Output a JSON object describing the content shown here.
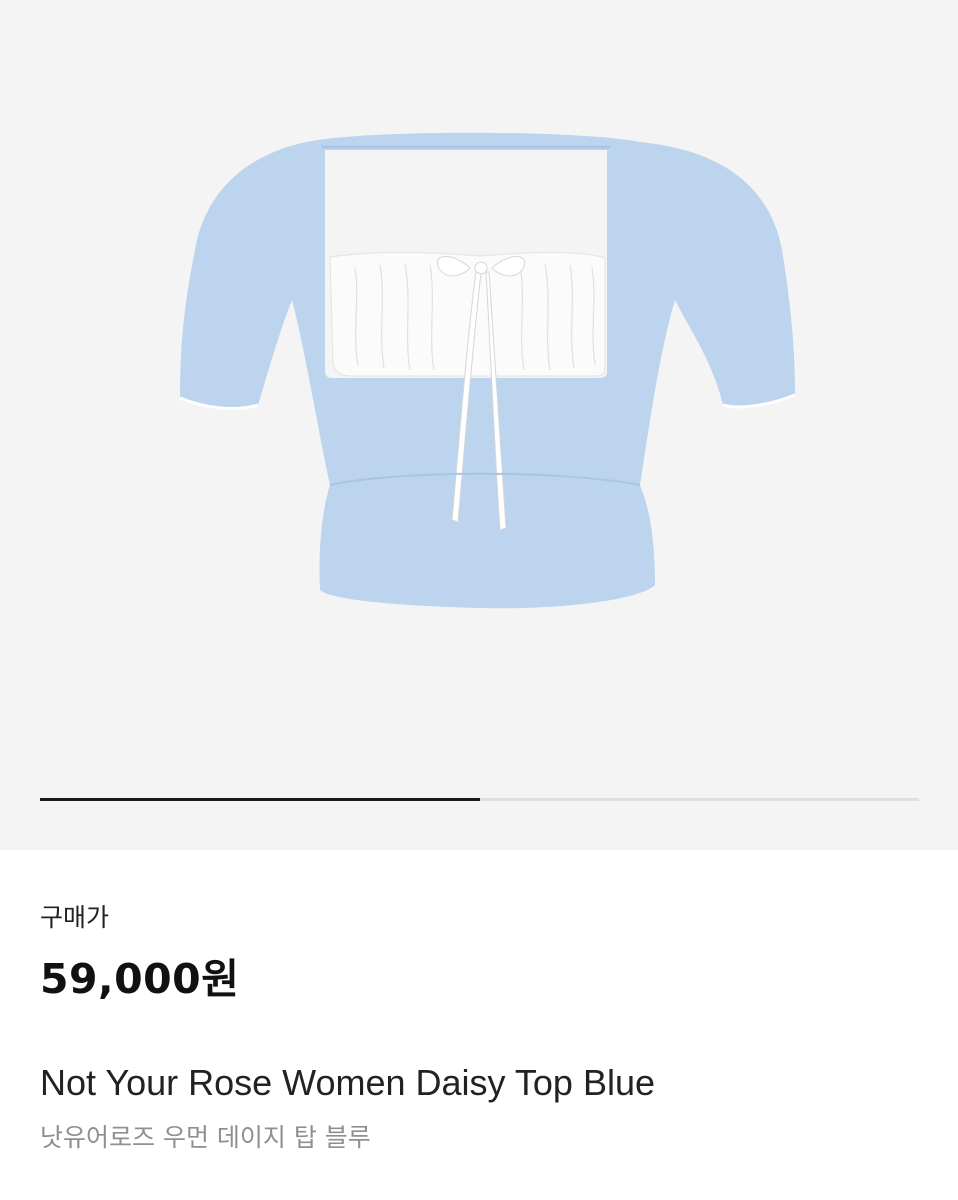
{
  "gallery": {
    "image_alt": "Not Your Rose Women Daisy Top Blue",
    "progress": 0.5,
    "progress_color": "#1a1a1a",
    "track_color": "#dedede",
    "background_color": "#f4f4f4"
  },
  "product": {
    "price_label": "구매가",
    "price": "59,000원",
    "name_en": "Not Your Rose Women Daisy Top Blue",
    "name_ko": "낫유어로즈 우먼 데이지 탑 블루",
    "garment_color": "#bcd4ee",
    "accent_color": "#ffffff"
  }
}
